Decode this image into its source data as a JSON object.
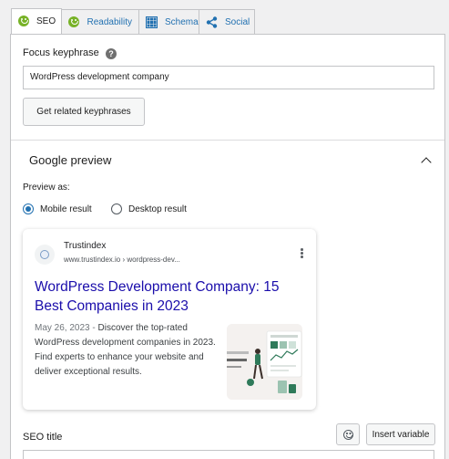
{
  "tabs": [
    {
      "label": "SEO",
      "icon": "smiley-icon",
      "active": true
    },
    {
      "label": "Readability",
      "icon": "smiley-icon",
      "active": false
    },
    {
      "label": "Schema",
      "icon": "grid-icon",
      "active": false
    },
    {
      "label": "Social",
      "icon": "share-icon",
      "active": false
    }
  ],
  "focus_keyphrase": {
    "label": "Focus keyphrase",
    "help": "?",
    "value": "WordPress development company"
  },
  "related_button": "Get related keyphrases",
  "google_preview": {
    "title": "Google preview",
    "preview_as_label": "Preview as:",
    "mobile_label": "Mobile result",
    "desktop_label": "Desktop result",
    "selected": "mobile"
  },
  "card": {
    "site_name": "Trustindex",
    "url": "www.trustindex.io › wordpress-dev...",
    "title": "WordPress Development Company: 15 Best Companies in 2023",
    "date": "May 26, 2023",
    "separator": " - ",
    "description": "Discover the top-rated WordPress development companies in 2023. Find experts to enhance your website and deliver exceptional results."
  },
  "seo_title": {
    "label": "SEO title",
    "insert_variable": "Insert variable"
  },
  "colors": {
    "accent": "#2271b1",
    "green": "#77b227",
    "google_link": "#1a0dab"
  }
}
